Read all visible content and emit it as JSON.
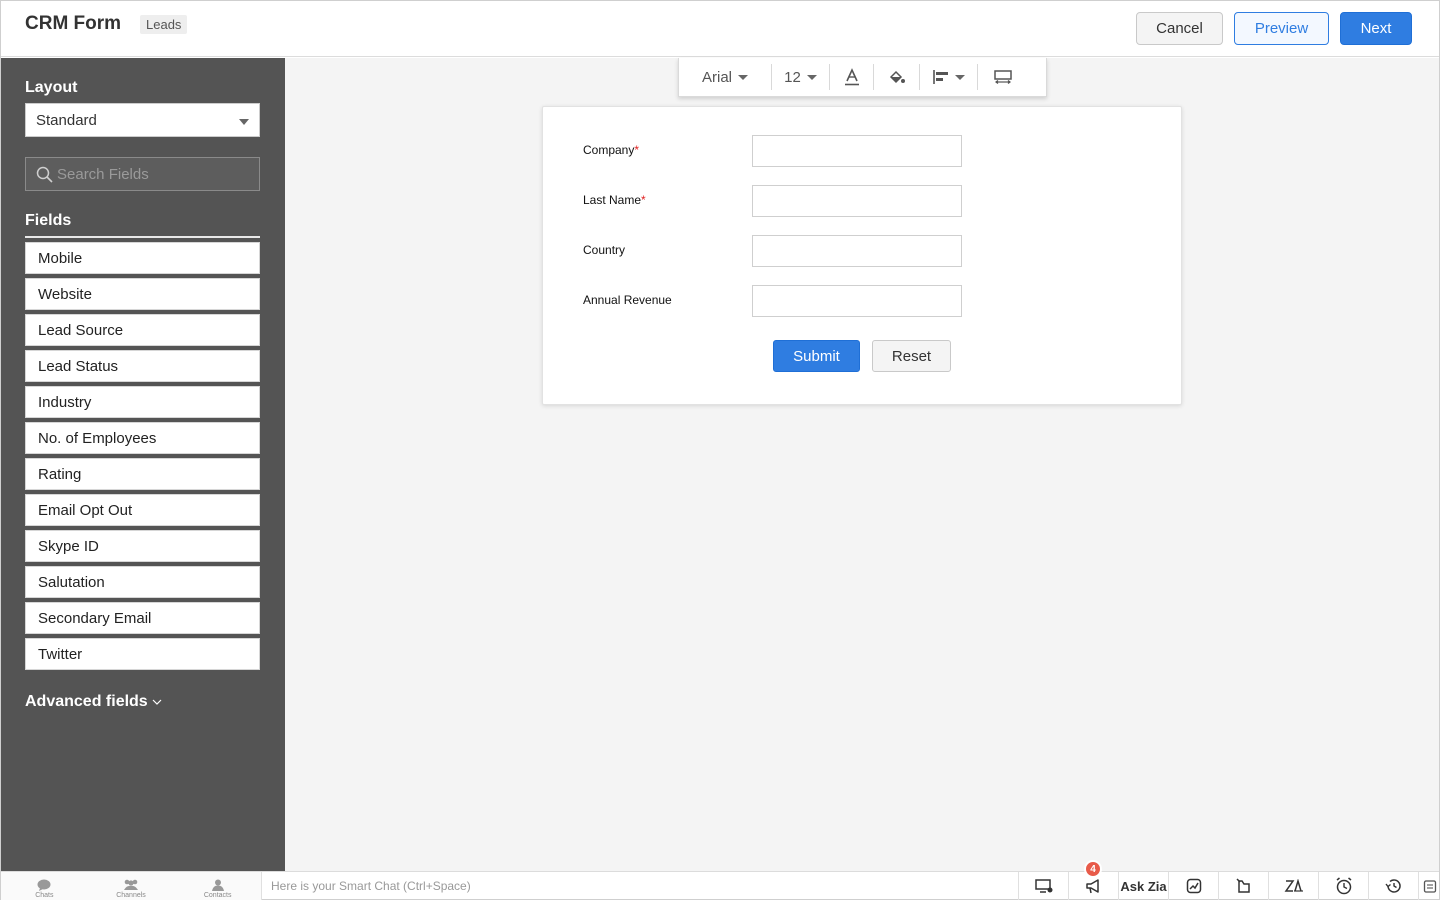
{
  "header": {
    "title": "CRM Form",
    "module_tag": "Leads",
    "cancel_label": "Cancel",
    "preview_label": "Preview",
    "next_label": "Next"
  },
  "sidebar": {
    "layout_label": "Layout",
    "layout_value": "Standard",
    "search_placeholder": "Search Fields",
    "fields_label": "Fields",
    "fields": [
      "Mobile",
      "Website",
      "Lead Source",
      "Lead Status",
      "Industry",
      "No. of Employees",
      "Rating",
      "Email Opt Out",
      "Skype ID",
      "Salutation",
      "Secondary Email",
      "Twitter"
    ],
    "advanced_label": "Advanced fields"
  },
  "toolbar": {
    "font": "Arial",
    "size": "12",
    "icons": [
      "text-color-icon",
      "fill-color-icon",
      "align-icon",
      "layout-width-icon"
    ]
  },
  "form": {
    "fields": [
      {
        "label": "Company",
        "required": "*",
        "value": ""
      },
      {
        "label": "Last Name",
        "required": "*",
        "value": ""
      },
      {
        "label": "Country",
        "required": "",
        "value": ""
      },
      {
        "label": "Annual Revenue",
        "required": "",
        "value": ""
      }
    ],
    "submit_label": "Submit",
    "reset_label": "Reset"
  },
  "bottombar": {
    "tabs": [
      "Chats",
      "Channels",
      "Contacts"
    ],
    "smart_chat_placeholder": "Here is your Smart Chat (Ctrl+Space)",
    "announcement_badge": "4",
    "ask_zia_label": "Ask Zia"
  },
  "colors": {
    "accent": "#2f7de1",
    "sidebar_bg": "#545454",
    "canvas_bg": "#f4f4f4",
    "required": "#e02020",
    "badge": "#e85b4a"
  }
}
